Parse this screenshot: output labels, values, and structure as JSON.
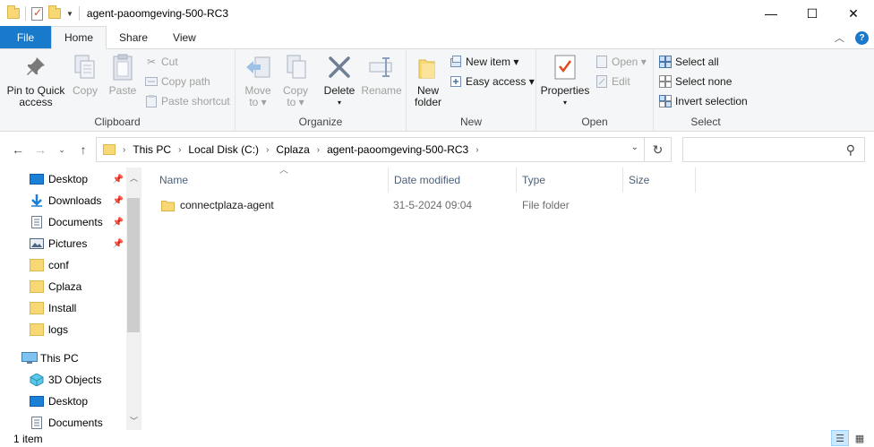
{
  "window": {
    "title": "agent-paoomgeving-500-RC3",
    "controls": {
      "minimize": "—",
      "maximize": "☐",
      "close": "✕"
    }
  },
  "ribbon_tabs": {
    "file": "File",
    "home": "Home",
    "share": "Share",
    "view": "View"
  },
  "ribbon": {
    "clipboard": {
      "label": "Clipboard",
      "pin_line1": "Pin to Quick",
      "pin_line2": "access",
      "copy": "Copy",
      "paste": "Paste",
      "cut": "Cut",
      "copy_path": "Copy path",
      "paste_shortcut": "Paste shortcut"
    },
    "organize": {
      "label": "Organize",
      "move_to": "Move",
      "move_to2": "to ▾",
      "copy_to": "Copy",
      "copy_to2": "to ▾",
      "delete": "Delete",
      "delete2": "▾",
      "rename": "Rename"
    },
    "new": {
      "label": "New",
      "new_folder1": "New",
      "new_folder2": "folder",
      "new_item": "New item ▾",
      "easy_access": "Easy access ▾"
    },
    "open": {
      "label": "Open",
      "properties": "Properties",
      "properties2": "▾",
      "open": "Open ▾",
      "edit": "Edit"
    },
    "select": {
      "label": "Select",
      "select_all": "Select all",
      "select_none": "Select none",
      "invert": "Invert selection"
    }
  },
  "address": {
    "crumbs": [
      "This PC",
      "Local Disk (C:)",
      "Cplaza",
      "agent-paoomgeving-500-RC3"
    ],
    "search_placeholder": ""
  },
  "nav_tree": [
    {
      "label": "Desktop",
      "icon": "desktop-icon",
      "pinned": true
    },
    {
      "label": "Downloads",
      "icon": "download-icon",
      "pinned": true
    },
    {
      "label": "Documents",
      "icon": "documents-icon",
      "pinned": true
    },
    {
      "label": "Pictures",
      "icon": "pictures-icon",
      "pinned": true
    },
    {
      "label": "conf",
      "icon": "folder-icon",
      "pinned": false
    },
    {
      "label": "Cplaza",
      "icon": "folder-icon",
      "pinned": false
    },
    {
      "label": "Install",
      "icon": "folder-icon",
      "pinned": false
    },
    {
      "label": "logs",
      "icon": "folder-icon",
      "pinned": false
    },
    {
      "label": "This PC",
      "icon": "this-pc-icon",
      "pinned": false
    },
    {
      "label": "3D Objects",
      "icon": "3d-objects-icon",
      "pinned": false
    },
    {
      "label": "Desktop",
      "icon": "desktop-icon",
      "pinned": false
    },
    {
      "label": "Documents",
      "icon": "documents-icon",
      "pinned": false
    }
  ],
  "columns": {
    "name": "Name",
    "date_modified": "Date modified",
    "type": "Type",
    "size": "Size"
  },
  "files": [
    {
      "name": "connectplaza-agent",
      "date_modified": "31-5-2024 09:04",
      "type": "File folder",
      "size": ""
    }
  ],
  "status": {
    "item_count": "1 item"
  },
  "colors": {
    "accent": "#1979ca",
    "folder": "#f8d775",
    "selected_view": "#cce8ff"
  }
}
